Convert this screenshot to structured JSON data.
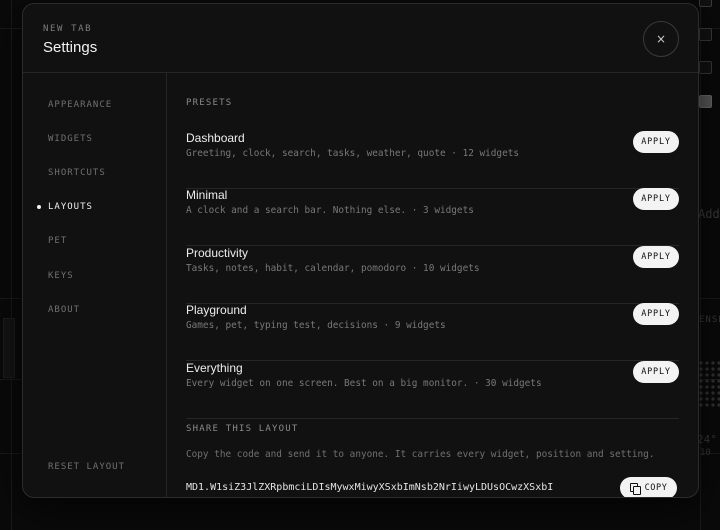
{
  "modal": {
    "eyebrow": "NEW TAB",
    "title": "Settings",
    "close_glyph": "×"
  },
  "sidebar": {
    "items": [
      {
        "label": "APPEARANCE",
        "active": false
      },
      {
        "label": "WIDGETS",
        "active": false
      },
      {
        "label": "SHORTCUTS",
        "active": false
      },
      {
        "label": "LAYOUTS",
        "active": true
      },
      {
        "label": "PET",
        "active": false
      },
      {
        "label": "KEYS",
        "active": false
      },
      {
        "label": "ABOUT",
        "active": false
      }
    ],
    "reset_label": "RESET LAYOUT"
  },
  "presets": {
    "section_label": "PRESETS",
    "items": [
      {
        "name": "Dashboard",
        "description": "Greeting, clock, search, tasks, weather, quote · 12 widgets",
        "action": "APPLY"
      },
      {
        "name": "Minimal",
        "description": "A clock and a search bar. Nothing else. · 3 widgets",
        "action": "APPLY"
      },
      {
        "name": "Productivity",
        "description": "Tasks, notes, habit, calendar, pomodoro · 10 widgets",
        "action": "APPLY"
      },
      {
        "name": "Playground",
        "description": "Games, pet, typing test, decisions · 9 widgets",
        "action": "APPLY"
      },
      {
        "name": "Everything",
        "description": "Every widget on one screen. Best on a big monitor. · 30 widgets",
        "action": "APPLY"
      }
    ]
  },
  "share": {
    "section_label": "SHARE THIS LAYOUT",
    "help": "Copy the code and send it to anyone. It carries every widget, position and setting.",
    "code": "MD1.W1siZ3JlZXRpbmciLDIsMywxMiwyXSxbImNsb2NrIiwyLDUsOCwzXSxbI",
    "copy_label": "COPY"
  },
  "background": {
    "fragment_add": "Add",
    "fragment_sense": "ENSE",
    "fragment_num": "24°",
    "fragment_small": "10"
  },
  "colors": {
    "page_bg": "#0a0a0a",
    "modal_bg": "#111111",
    "button_bg": "#f3f3f3",
    "text_primary": "#ededed",
    "text_muted": "#787878"
  }
}
